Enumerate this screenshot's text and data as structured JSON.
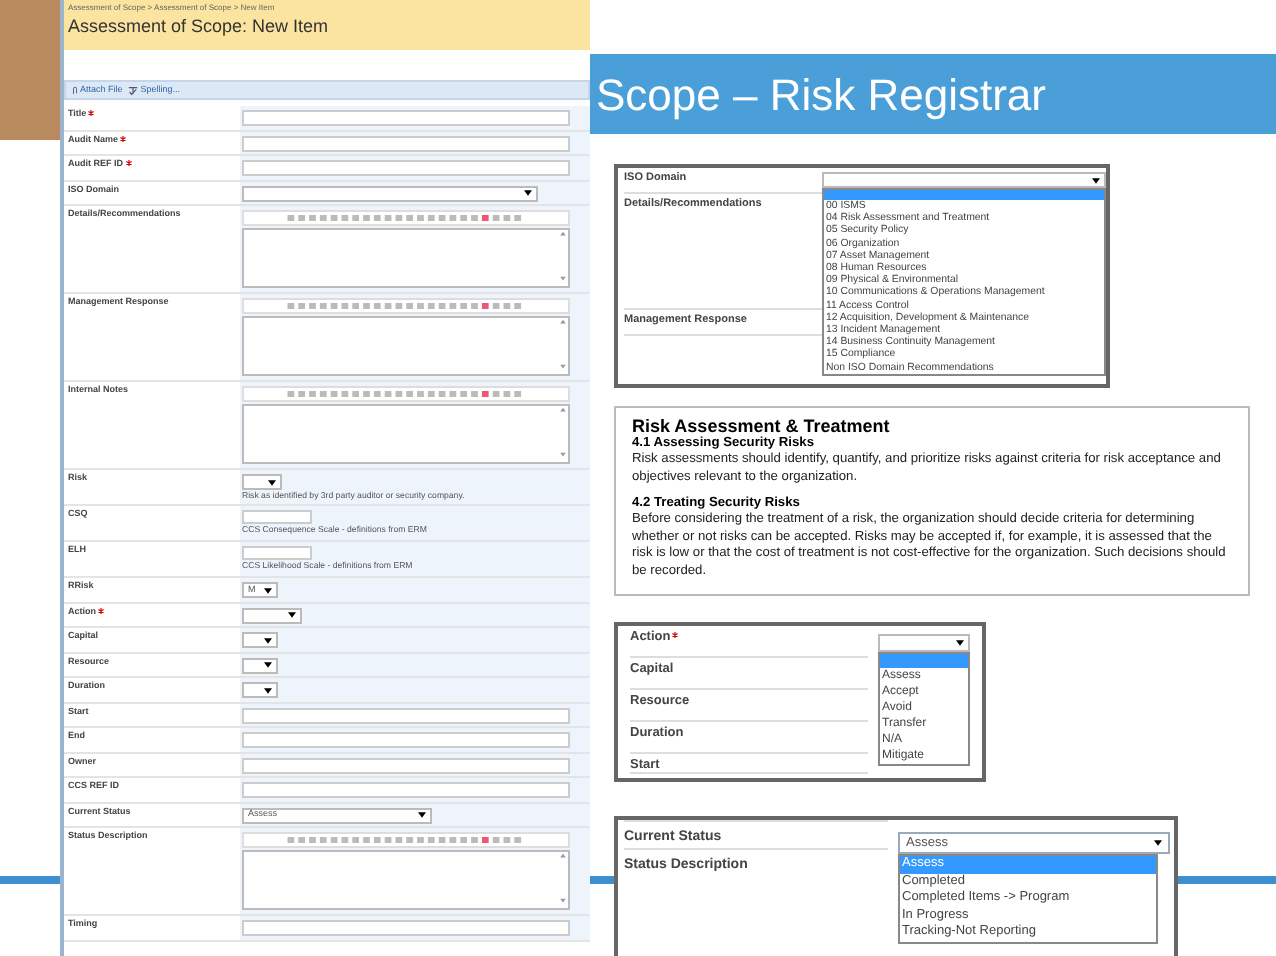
{
  "slide_title": "Scope – Risk Registrar",
  "form": {
    "breadcrumb": "Assessment of Scope > Assessment of Scope > New Item",
    "title": "Assessment of Scope: New Item",
    "toolbar": [
      {
        "kind": "attach",
        "label": "Attach File"
      },
      {
        "kind": "spelling",
        "label": "Spelling..."
      }
    ],
    "fields": [
      {
        "label": "Title",
        "required": true,
        "kind": "text"
      },
      {
        "label": "Audit Name",
        "required": true,
        "kind": "text"
      },
      {
        "label": "Audit REF ID",
        "required": true,
        "kind": "text"
      },
      {
        "label": "ISO Domain",
        "required": false,
        "kind": "combo"
      },
      {
        "label": "Details/Recommendations",
        "required": false,
        "kind": "richtext"
      },
      {
        "label": "Management Response",
        "required": false,
        "kind": "richtext"
      },
      {
        "label": "Internal Notes",
        "required": false,
        "kind": "richtext"
      },
      {
        "label": "Risk",
        "required": false,
        "kind": "selectnote",
        "hint": "Risk as identified by 3rd party auditor or security company."
      },
      {
        "label": "CSQ",
        "required": false,
        "kind": "inputnote",
        "hint": "CCS Consequence Scale - definitions from ERM"
      },
      {
        "label": "ELH",
        "required": false,
        "kind": "inputnote",
        "hint": "CCS Likelihood Scale - definitions from ERM"
      },
      {
        "label": "RRisk",
        "required": false,
        "kind": "mini",
        "value": "M"
      },
      {
        "label": "Action",
        "required": true,
        "kind": "select"
      },
      {
        "label": "Capital",
        "required": false,
        "kind": "mini"
      },
      {
        "label": "Resource",
        "required": false,
        "kind": "mini"
      },
      {
        "label": "Duration",
        "required": false,
        "kind": "mini"
      },
      {
        "label": "Start",
        "required": false,
        "kind": "text"
      },
      {
        "label": "End",
        "required": false,
        "kind": "text"
      },
      {
        "label": "Owner",
        "required": false,
        "kind": "text"
      },
      {
        "label": "CCS REF ID",
        "required": false,
        "kind": "text"
      },
      {
        "label": "Current Status",
        "required": false,
        "kind": "select",
        "value": "Assess"
      },
      {
        "label": "Status Description",
        "required": false,
        "kind": "richtext"
      },
      {
        "label": "Timing",
        "required": false,
        "kind": "text"
      }
    ]
  },
  "iso_inset": {
    "rows": [
      {
        "label": "ISO Domain"
      },
      {
        "label": "Details/Recommendations"
      },
      {
        "label": "Management Response"
      }
    ],
    "dropdown": {
      "blank_highlighted": true,
      "options": [
        "00 ISMS",
        "04 Risk Assessment and Treatment",
        "05 Security Policy",
        "06 Organization",
        "07 Asset Management",
        "08 Human Resources",
        "09 Physical & Environmental",
        "10 Communications & Operations Management",
        "11 Access Control",
        "12 Acquisition, Development & Maintenance",
        "13 Incident Management",
        "14 Business Continuity Management",
        "15 Compliance",
        "Non ISO Domain Recommendations"
      ]
    }
  },
  "guidance": {
    "title": "Risk Assessment & Treatment",
    "sections": [
      {
        "heading": "4.1 Assessing Security Risks",
        "body": "Risk assessments should identify, quantify, and prioritize risks against criteria for risk acceptance and objectives relevant to the organization."
      },
      {
        "heading": "4.2 Treating Security Risks",
        "body": "Before considering the treatment of a risk, the organization should decide criteria for determining whether or not risks can be accepted. Risks may be accepted if, for example, it is assessed that the risk is low or that the cost of treatment is not cost-effective for the organization. Such decisions should be recorded."
      }
    ]
  },
  "action_inset": {
    "rows": [
      {
        "label": "Action",
        "required": true
      },
      {
        "label": "Capital",
        "required": false
      },
      {
        "label": "Resource",
        "required": false
      },
      {
        "label": "Duration",
        "required": false
      },
      {
        "label": "Start",
        "required": false
      }
    ],
    "dropdown": {
      "blank_highlighted": true,
      "options": [
        "Assess",
        "Accept",
        "Avoid",
        "Transfer",
        "N/A",
        "Mitigate"
      ]
    }
  },
  "status_inset": {
    "rows": [
      {
        "label": "Current Status"
      },
      {
        "label": "Status Description"
      }
    ],
    "dropdown": {
      "value": "Assess",
      "options": [
        {
          "label": "Assess",
          "selected": true
        },
        {
          "label": "Completed",
          "selected": false
        },
        {
          "label": "Completed Items -> Program",
          "selected": false
        },
        {
          "label": "In Progress",
          "selected": false
        },
        {
          "label": "Tracking-Not Reporting",
          "selected": false
        }
      ]
    }
  }
}
